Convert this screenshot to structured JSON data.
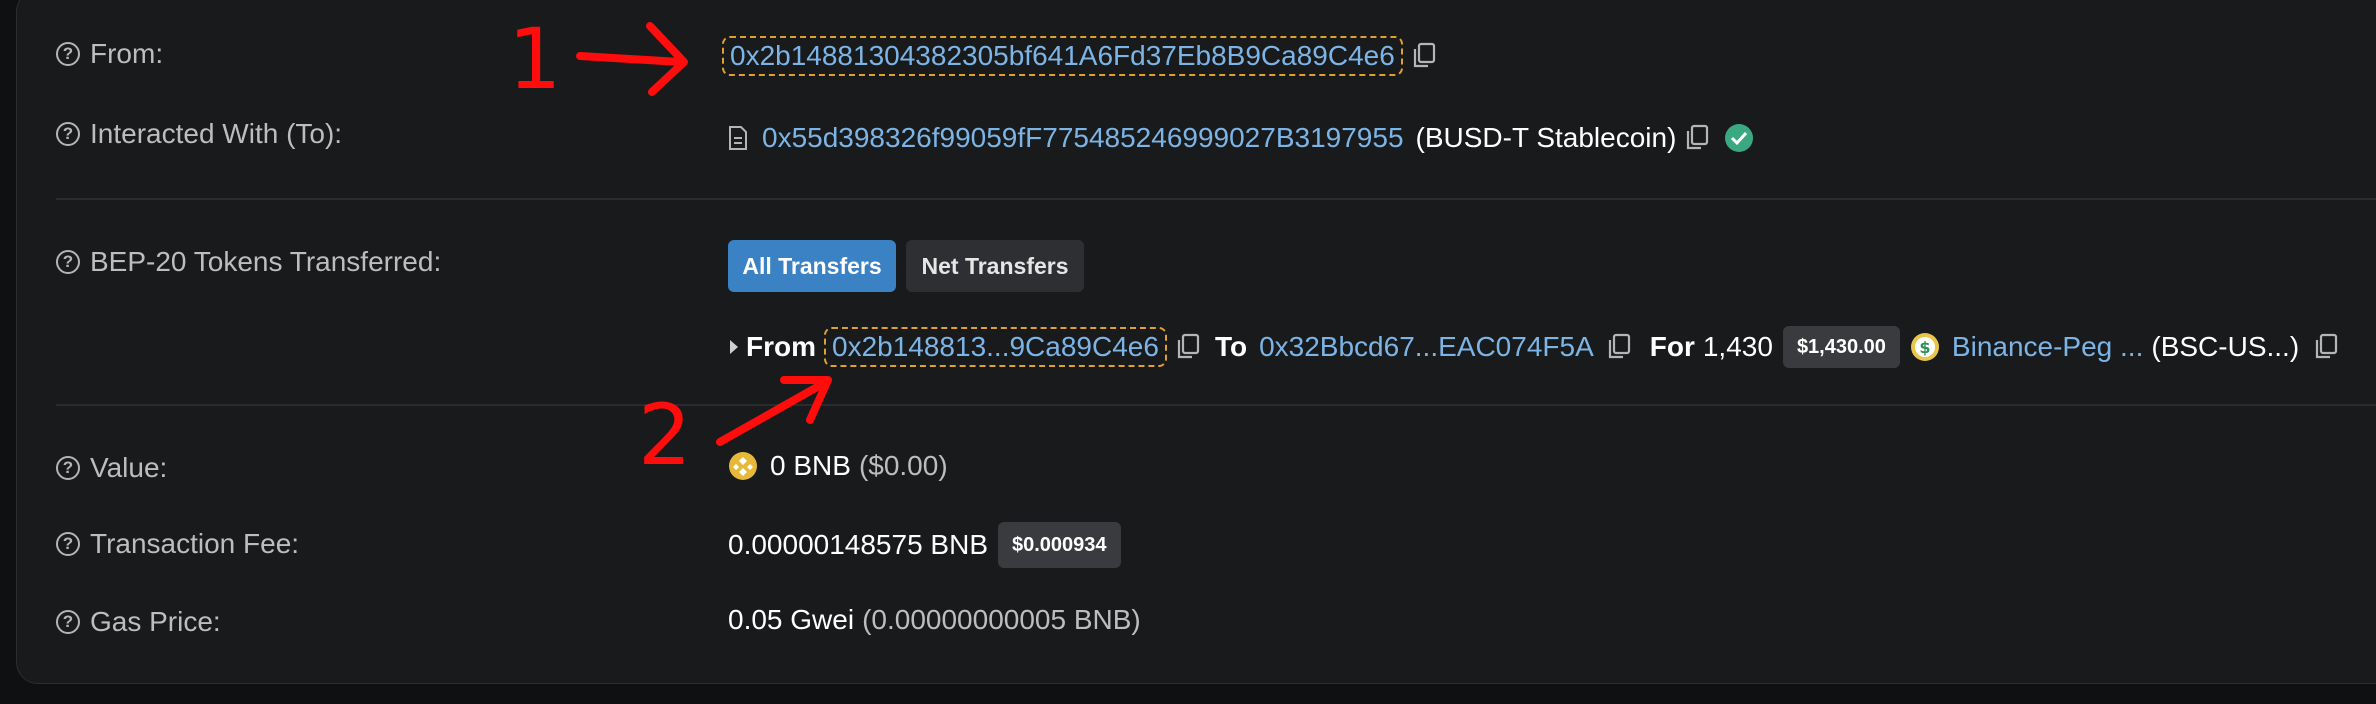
{
  "from": {
    "label": "From:",
    "address": "0x2b14881304382305bf641A6Fd37Eb8B9Ca89C4e6"
  },
  "interacted": {
    "label": "Interacted With (To):",
    "address": "0x55d398326f99059fF775485246999027B3197955",
    "name": "(BUSD-T Stablecoin)"
  },
  "tokens": {
    "label": "BEP-20 Tokens Transferred:",
    "tabs": {
      "all": "All Transfers",
      "net": "Net Transfers"
    },
    "transfer": {
      "from_word": "From",
      "from": "0x2b148813...9Ca89C4e6",
      "to_word": "To",
      "to": "0x32Bbcd67...EAC074F5A",
      "for_word": "For",
      "amount": "1,430",
      "usd": "$1,430.00",
      "token": "Binance-Peg ...",
      "symbol": "(BSC-US...)"
    }
  },
  "value": {
    "label": "Value:",
    "amount": "0 BNB",
    "usd": "($0.00)"
  },
  "fee": {
    "label": "Transaction Fee:",
    "amount": "0.00000148575 BNB",
    "usd": "$0.000934"
  },
  "gas": {
    "label": "Gas Price:",
    "amount": "0.05 Gwei",
    "bnb": "(0.00000000005 BNB)"
  },
  "annotations": {
    "one": "1",
    "two": "2"
  },
  "colors": {
    "link": "#7cb4e6",
    "active_tab": "#3b82c4",
    "annotation": "#ff0c0c",
    "verified": "#3aa981"
  }
}
